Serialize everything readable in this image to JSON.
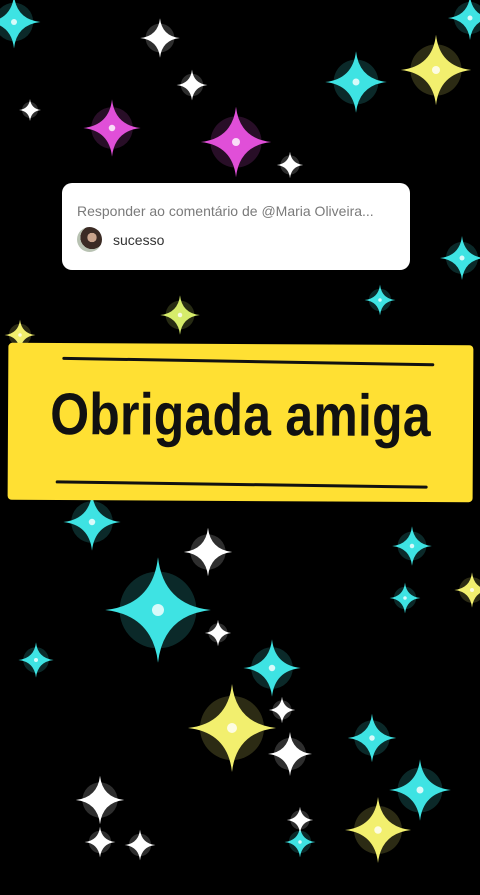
{
  "background": {
    "color": "#000000",
    "sparkle_colors": [
      "#3ee3e3",
      "#ffffff",
      "#f2ef6e",
      "#e04fd8",
      "#d6ec6b"
    ]
  },
  "reply_card": {
    "label": "Responder ao comentário de @Maria Oliveira...",
    "comment": "sucesso",
    "avatar": "user-avatar"
  },
  "banner": {
    "text": "Obrigada amiga",
    "color": "#ffe033"
  }
}
